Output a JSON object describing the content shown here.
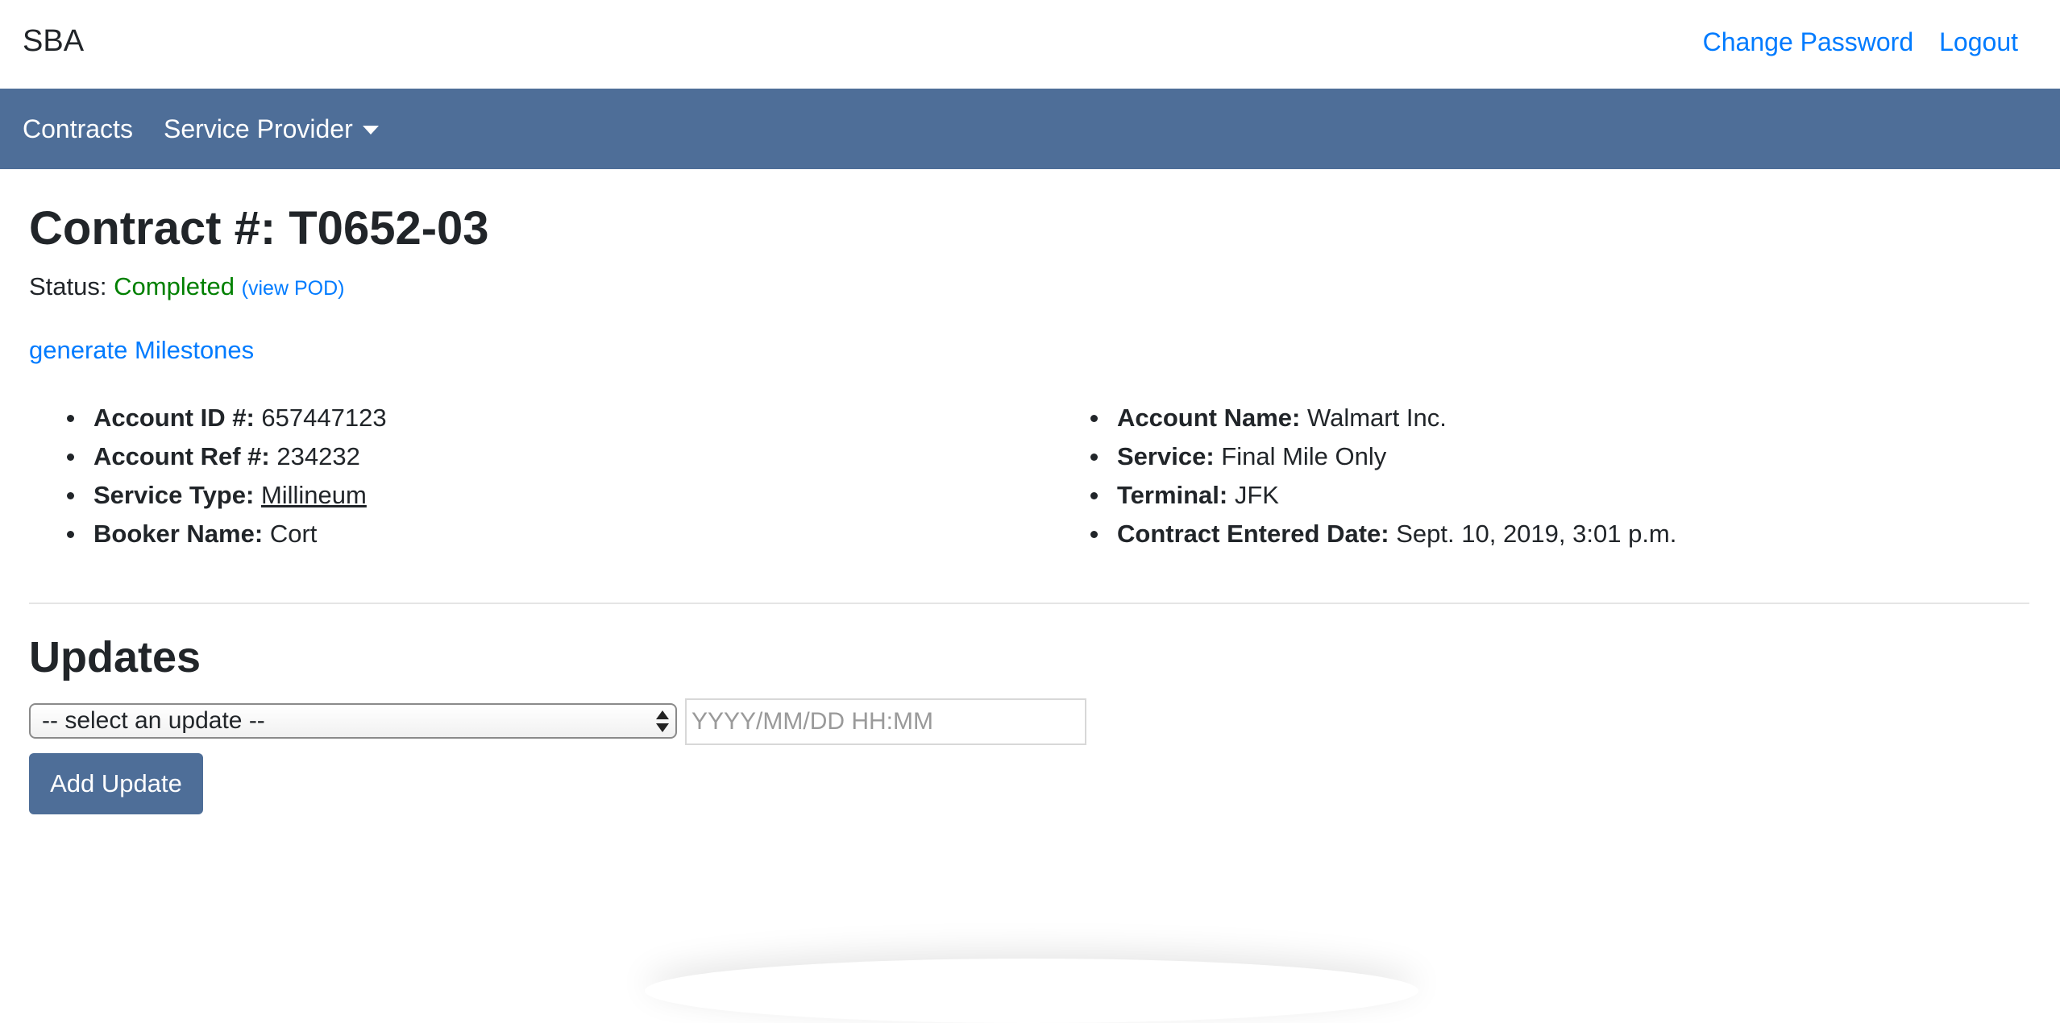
{
  "header": {
    "brand": "SBA",
    "links": {
      "change_password": "Change Password",
      "logout": "Logout"
    }
  },
  "navbar": {
    "contracts": "Contracts",
    "service_provider": "Service Provider"
  },
  "contract": {
    "title": "Contract #: T0652-03",
    "status_label": "Status:",
    "status_value": "Completed",
    "view_pod": "(view POD)",
    "generate_milestones": "generate Milestones",
    "details_left": [
      {
        "label": "Account ID #:",
        "value": "657447123"
      },
      {
        "label": "Account Ref #:",
        "value": "234232"
      },
      {
        "label": "Service Type:",
        "value": "Millineum"
      },
      {
        "label": "Booker Name:",
        "value": "Cort"
      }
    ],
    "details_right": [
      {
        "label": "Account Name:",
        "value": "Walmart Inc."
      },
      {
        "label": "Service:",
        "value": "Final Mile Only"
      },
      {
        "label": "Terminal:",
        "value": "JFK"
      },
      {
        "label": "Contract Entered Date:",
        "value": "Sept. 10, 2019, 3:01 p.m."
      }
    ]
  },
  "updates": {
    "title": "Updates",
    "select_value": "-- select an update --",
    "datetime_placeholder": "YYYY/MM/DD HH:MM",
    "datetime_value": "",
    "add_button": "Add Update"
  },
  "colors": {
    "navbar": "#4e6e98",
    "link": "#007bff",
    "status_completed": "#008000"
  }
}
